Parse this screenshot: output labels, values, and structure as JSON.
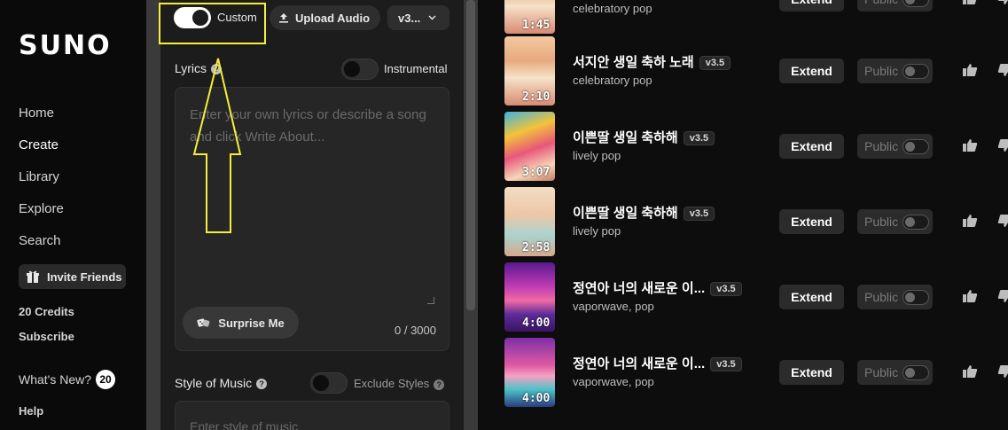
{
  "sidebar": {
    "logo": "SUNO",
    "nav": [
      "Home",
      "Create",
      "Library",
      "Explore",
      "Search"
    ],
    "invite": "Invite Friends",
    "credits": "20 Credits",
    "subscribe": "Subscribe",
    "whats_new": "What's New?",
    "whats_new_count": "20",
    "help": "Help"
  },
  "create": {
    "custom_label": "Custom",
    "custom_on": true,
    "upload_audio": "Upload Audio",
    "version": "v3...",
    "lyrics_label": "Lyrics",
    "instrumental_label": "Instrumental",
    "lyrics_placeholder": "Enter your own lyrics or describe a song and click Write About...",
    "surprise_me": "Surprise Me",
    "counter": "0 / 3000",
    "style_label": "Style of Music",
    "exclude_styles": "Exclude Styles",
    "style_placeholder": "Enter style of music"
  },
  "songs": [
    {
      "title": "",
      "version": "",
      "genre": "celebratory pop",
      "duration": "1:45",
      "theme": "cake"
    },
    {
      "title": "서지안 생일 축하 노래",
      "version": "v3.5",
      "genre": "celebratory pop",
      "duration": "2:10",
      "theme": "cake"
    },
    {
      "title": "이쁜딸 생일 축하해",
      "version": "v3.5",
      "genre": "lively pop",
      "duration": "3:07",
      "theme": "balloons"
    },
    {
      "title": "이쁜딸 생일 축하해",
      "version": "v3.5",
      "genre": "lively pop",
      "duration": "2:58",
      "theme": "candles"
    },
    {
      "title": "정연아 너의 새로운 이...",
      "version": "v3.5",
      "genre": "vaporwave, pop",
      "duration": "4:00",
      "theme": "vapor"
    },
    {
      "title": "정연아 너의 새로운 이...",
      "version": "v3.5",
      "genre": "vaporwave, pop",
      "duration": "4:00",
      "theme": "vapor2"
    }
  ],
  "row_actions": {
    "extend": "Extend",
    "public": "Public"
  },
  "colors": {
    "annotation": "#f5ee3a",
    "panel": "#1c1c1c",
    "bg": "#0d0d0d"
  }
}
